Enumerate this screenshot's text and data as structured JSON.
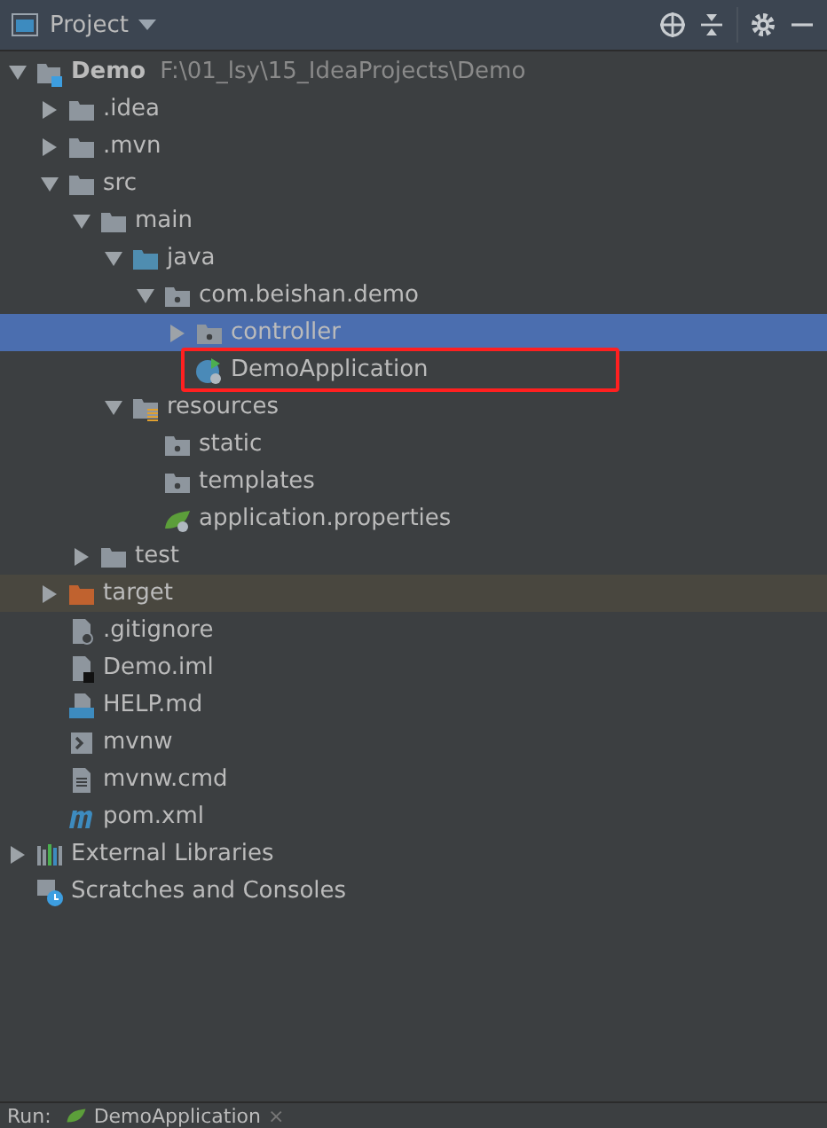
{
  "panel": {
    "title": "Project"
  },
  "tree": [
    {
      "name": "Demo",
      "path": "F:\\01_lsy\\15_IdeaProjects\\Demo",
      "kind": "module",
      "expanded": true,
      "selected": false,
      "children": [
        {
          "name": ".idea",
          "kind": "folder",
          "expanded": false,
          "selected": false
        },
        {
          "name": ".mvn",
          "kind": "folder",
          "expanded": false,
          "selected": false
        },
        {
          "name": "src",
          "kind": "folder",
          "expanded": true,
          "selected": false,
          "children": [
            {
              "name": "main",
              "kind": "folder",
              "expanded": true,
              "selected": false,
              "children": [
                {
                  "name": "java",
                  "kind": "source-folder",
                  "expanded": true,
                  "selected": false,
                  "children": [
                    {
                      "name": "com.beishan.demo",
                      "kind": "package",
                      "expanded": true,
                      "selected": false,
                      "children": [
                        {
                          "name": "controller",
                          "kind": "package",
                          "expanded": false,
                          "selected": true
                        },
                        {
                          "name": "DemoApplication",
                          "kind": "spring-class",
                          "selected": false,
                          "annotated": true
                        }
                      ]
                    }
                  ]
                },
                {
                  "name": "resources",
                  "kind": "resources-folder",
                  "expanded": true,
                  "selected": false,
                  "children": [
                    {
                      "name": "static",
                      "kind": "package",
                      "selected": false
                    },
                    {
                      "name": "templates",
                      "kind": "package",
                      "selected": false
                    },
                    {
                      "name": "application.properties",
                      "kind": "spring-properties",
                      "selected": false
                    }
                  ]
                }
              ]
            },
            {
              "name": "test",
              "kind": "folder",
              "expanded": false,
              "selected": false
            }
          ]
        },
        {
          "name": "target",
          "kind": "excluded-folder",
          "expanded": false,
          "selected": false,
          "excluded": true
        },
        {
          "name": ".gitignore",
          "kind": "ignore-file",
          "selected": false
        },
        {
          "name": "Demo.iml",
          "kind": "module-file",
          "selected": false
        },
        {
          "name": "HELP.md",
          "kind": "markdown-file",
          "selected": false
        },
        {
          "name": "mvnw",
          "kind": "script-file",
          "selected": false
        },
        {
          "name": "mvnw.cmd",
          "kind": "text-file",
          "selected": false
        },
        {
          "name": "pom.xml",
          "kind": "maven-file",
          "selected": false
        }
      ]
    },
    {
      "name": "External Libraries",
      "kind": "libraries",
      "expanded": false,
      "selected": false
    },
    {
      "name": "Scratches and Consoles",
      "kind": "scratches",
      "selected": false
    }
  ],
  "run_bar": {
    "label": "Run:",
    "tab": "DemoApplication",
    "close": "×"
  }
}
